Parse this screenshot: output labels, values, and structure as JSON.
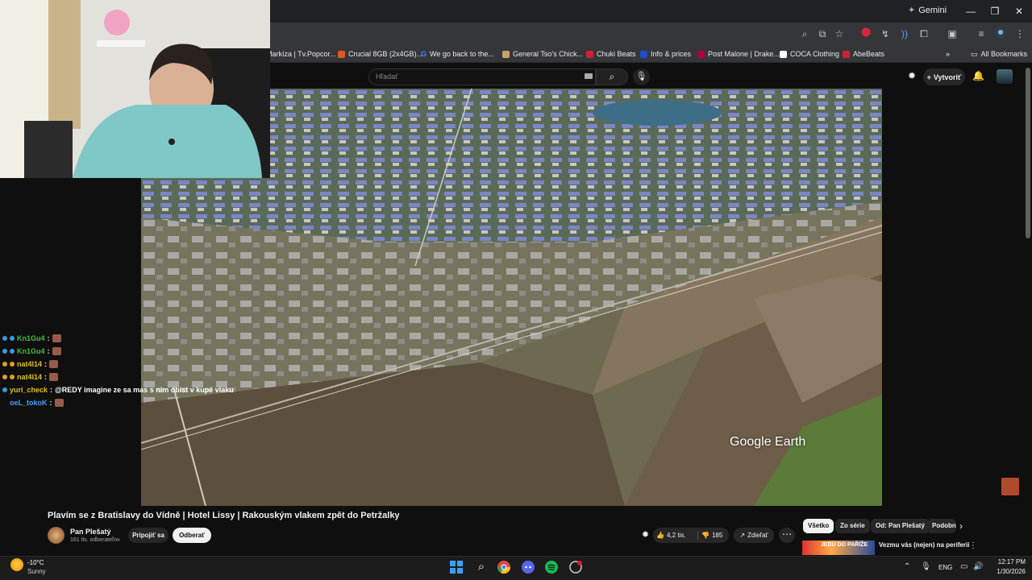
{
  "browser": {
    "gemini_label": "Gemini",
    "bookmarks": [
      {
        "label": "Markíza | Tv.Popcor...",
        "color": "#6b6b6b"
      },
      {
        "label": "Crucial 8GB (2x4GB)...",
        "color": "#e05a16"
      },
      {
        "label": "We go back to the...",
        "color": "#4285f4"
      },
      {
        "label": "General Tso's Chick...",
        "color": "#c9a36a"
      },
      {
        "label": "Chuki Beats",
        "color": "#cc2233"
      },
      {
        "label": "Info & prices",
        "color": "#1a4fcf"
      },
      {
        "label": "Post Malone | Drake...",
        "color": "#b0003a"
      },
      {
        "label": "COCA Clothing",
        "color": "#333333"
      },
      {
        "label": "AbeBeats",
        "color": "#cc2233"
      }
    ],
    "all_bookmarks_label": "All Bookmarks",
    "window_controls": {
      "minimize": "—",
      "restore": "❐",
      "close": "✕"
    }
  },
  "youtube": {
    "search_placeholder": "Hľadať",
    "create_label": "Vytvoriť",
    "video_overlay_text": "Google Earth",
    "title": "Plavím se z Bratislavy do Vídně | Hotel Lissy | Rakouským vlakem zpět do Petržalky",
    "channel": {
      "name": "Pan Plešatý",
      "subscribers": "161 tis. odberateľov"
    },
    "join_label": "Pripojiť sa",
    "unsubscribe_label": "Odberať",
    "likes": "4,2 tis.",
    "dislikes": "185",
    "share_label": "Zdieľať",
    "chips": [
      "Všetko",
      "Zo série",
      "Od: Pan Plešatý",
      "Podobn"
    ],
    "recommendation": {
      "title": "Vezmu vás (nejen) na periferii",
      "thumb_text": "JEDU DO PAŘÍŽE"
    }
  },
  "chat": [
    {
      "user": "Kn1Gu4",
      "user_color": "#3fbf3f",
      "badge_colors": [
        "#3a9bdc",
        "#3a9bdc"
      ],
      "message": "",
      "emote": true
    },
    {
      "user": "Kn1Gu4",
      "user_color": "#3fbf3f",
      "badge_colors": [
        "#3a9bdc",
        "#3a9bdc"
      ],
      "message": "",
      "emote": true
    },
    {
      "user": "nat4l14",
      "user_color": "#e0c020",
      "badge_colors": [
        "#e0a020",
        "#e0a020"
      ],
      "message": "",
      "emote": true
    },
    {
      "user": "nat4l14",
      "user_color": "#e0c020",
      "badge_colors": [
        "#e0a020",
        "#e0a020"
      ],
      "message": "",
      "emote": true
    },
    {
      "user": "yuri_check",
      "user_color": "#e0c020",
      "badge_colors": [
        "#3a9bdc"
      ],
      "message": "@REDY imagine ze sa mas s nim obist v kupé vlaku",
      "emote": false
    },
    {
      "user": "oeL_tokoK",
      "user_color": "#4aa0ff",
      "badge_colors": [],
      "message": "",
      "emote": true
    }
  ],
  "taskbar": {
    "weather_temp": "-10°C",
    "weather_cond": "Sunny",
    "language": "ENG",
    "time": "12:17 PM",
    "date": "1/30/2026"
  }
}
